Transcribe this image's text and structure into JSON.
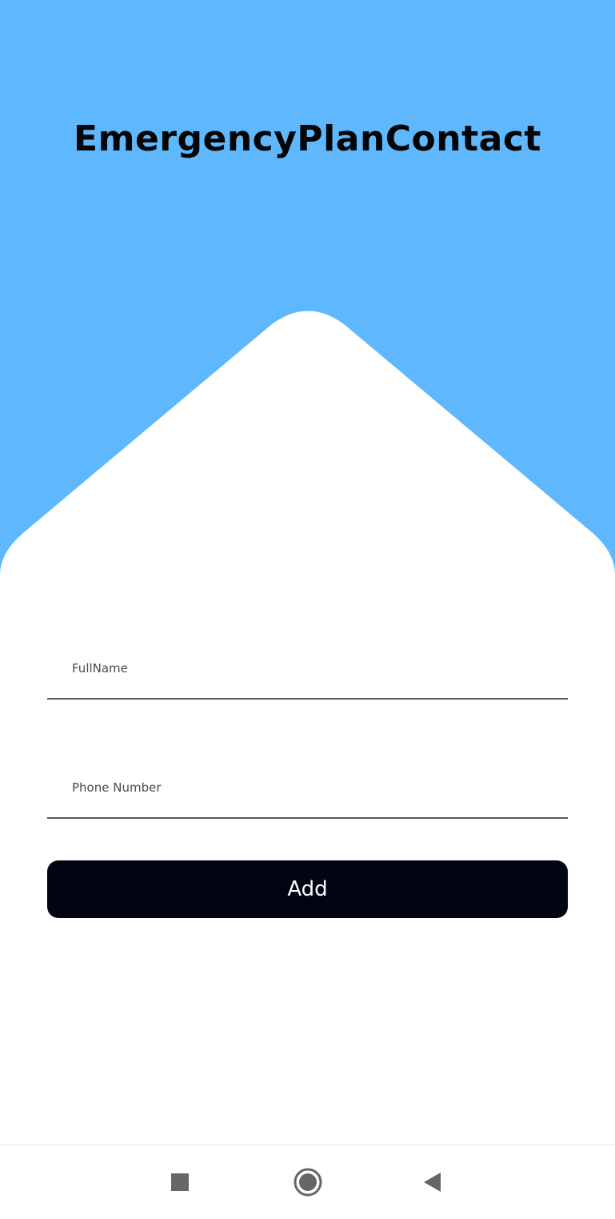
{
  "app": {
    "title": "EmergencyPlanContact"
  },
  "form": {
    "fullname_placeholder": "FullName",
    "fullname_value": "",
    "phone_placeholder": "Phone Number",
    "phone_value": "",
    "add_label": "Add"
  },
  "navigation": {
    "buttons": [
      {
        "icon": "square-recents-icon"
      },
      {
        "icon": "circle-home-icon"
      },
      {
        "icon": "triangle-back-icon"
      }
    ]
  },
  "colors": {
    "header_background": "#5FB8FD",
    "page_background": "#FFFFFF",
    "button_background": "#010413",
    "button_text": "#FFFFFF",
    "title_text": "#050505",
    "nav_icon": "#666666"
  }
}
